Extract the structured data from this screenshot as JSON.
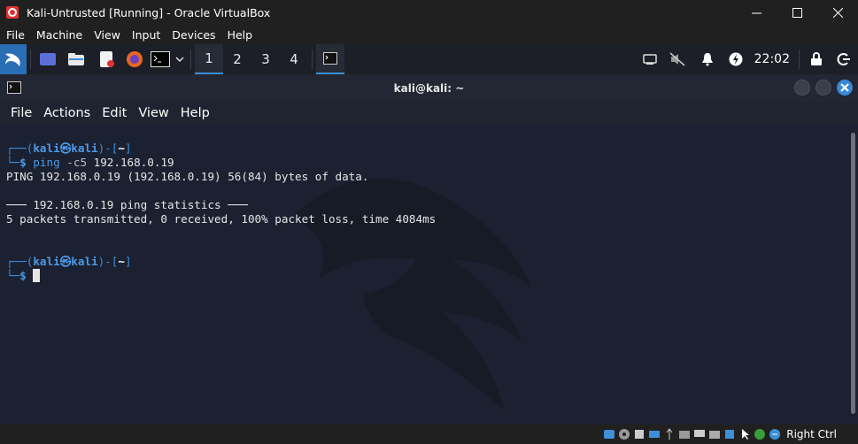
{
  "host": {
    "title": "Kali-Untrusted [Running] - Oracle VirtualBox",
    "menu": [
      "File",
      "Machine",
      "View",
      "Input",
      "Devices",
      "Help"
    ],
    "status_right_label": "Right Ctrl"
  },
  "panel": {
    "workspaces": [
      "1",
      "2",
      "3",
      "4"
    ],
    "active_workspace": "1",
    "clock": "22:02"
  },
  "terminal": {
    "title": "kali@kali: ~",
    "menu": [
      "File",
      "Actions",
      "Edit",
      "View",
      "Help"
    ],
    "lines": {
      "p1_user": "kali",
      "p1_at": "㉿",
      "p1_host": "kali",
      "p1_dir": "~",
      "cmd_name": "ping",
      "cmd_flag": "-c5",
      "cmd_arg": "192.168.0.19",
      "out1": "PING 192.168.0.19 (192.168.0.19) 56(84) bytes of data.",
      "out2": "─── 192.168.0.19 ping statistics ───",
      "out3": "5 packets transmitted, 0 received, 100% packet loss, time 4084ms",
      "p2_user": "kali",
      "p2_at": "㉿",
      "p2_host": "kali",
      "p2_dir": "~"
    }
  },
  "colors": {
    "accent": "#3d8fd8",
    "prompt_blue": "#4d9ae8",
    "terminal_bg": "#1b2130"
  }
}
